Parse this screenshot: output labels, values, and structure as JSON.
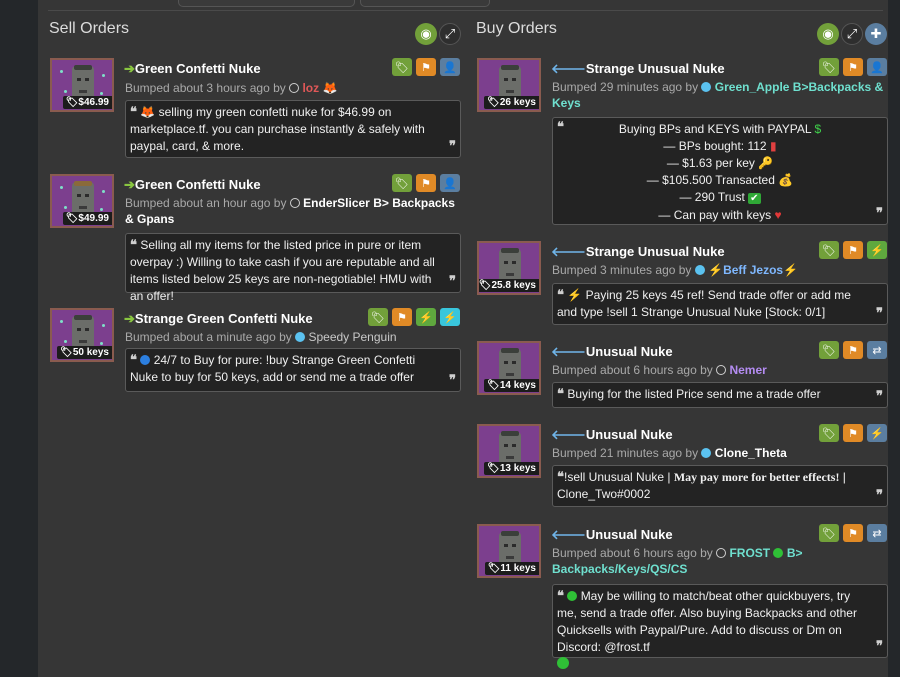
{
  "sell": {
    "title": "Sell Orders",
    "listings": [
      {
        "name": "Green Confetti Nuke",
        "price": "$46.99",
        "bumped": "Bumped about 3 hours ago by",
        "user": "loz",
        "comment": "selling my green confetti nuke for $46.99 on marketplace.tf. you can purchase instantly & safely with paypal, card, & more."
      },
      {
        "name": "Green Confetti Nuke",
        "price": "$49.99",
        "bumped": "Bumped about an hour ago by",
        "user": "EnderSlicer B> Backpacks & Gpans",
        "comment": "Selling all my items for the listed price in pure or item overpay :) Willing to take cash if you are reputable and all items listed below 25 keys are non-negotiable! HMU with an offer!"
      },
      {
        "name": "Strange Green Confetti Nuke",
        "price": "50 keys",
        "bumped": "Bumped about a minute ago by",
        "user": "Speedy Penguin",
        "comment": "24/7 to Buy for pure: !buy Strange Green Confetti Nuke to buy for 50 keys, add or send me a trade offer"
      }
    ]
  },
  "buy": {
    "title": "Buy Orders",
    "listings": [
      {
        "name": "Strange Unusual Nuke",
        "price": "26 keys",
        "bumped": "Bumped 29 minutes ago by",
        "user": "Green_Apple B>Backpacks & Keys",
        "comment_lines": [
          "Buying BPs and KEYS with PAYPAL",
          "— BPs bought: 112",
          "— $1.63 per key",
          "— $105.500 Transacted",
          "— 290 Trust",
          "— Can pay with keys"
        ]
      },
      {
        "name": "Strange Unusual Nuke",
        "price": "25.8 keys",
        "bumped": "Bumped 3 minutes ago by",
        "user": "Beff Jezos",
        "comment": "Paying 25 keys 45 ref! Send trade offer or add me and type !sell 1 Strange Unusual Nuke [Stock: 0/1]"
      },
      {
        "name": "Unusual Nuke",
        "price": "14 keys",
        "bumped": "Bumped about 6 hours ago by",
        "user": "Nemer",
        "comment": "Buying for the listed Price send me a trade offer"
      },
      {
        "name": "Unusual Nuke",
        "price": "13 keys",
        "bumped": "Bumped 21 minutes ago by",
        "user": "Clone_Theta",
        "comment_a": "!sell Unusual Nuke | ",
        "comment_b": "May pay more for better effects!",
        "comment_c": " | Clone_Two#0002"
      },
      {
        "name": "Unusual Nuke",
        "price": "11 keys",
        "bumped": "Bumped about 6 hours ago by",
        "user_a": "FROST",
        "user_b": "B> Backpacks/Keys/QS/CS",
        "comment": "May be willing to match/beat other quickbuyers, try me, send a trade offer. Also buying Backpacks and other Quicksells with Paypal/Pure. Add to discuss or Dm on Discord: @frost.tf"
      }
    ]
  },
  "colors": {
    "panel": "#363636",
    "green_button": "#72a03a",
    "orange_button": "#e08a26",
    "blue_button": "#5b7ea0",
    "item_bg": "#7c3f8e"
  },
  "icons": [
    "eye-icon",
    "expand-icon",
    "plus-icon",
    "tag-icon",
    "flag-icon",
    "add-friend-icon",
    "lightning-icon",
    "transfer-icon",
    "quote-icon"
  ]
}
